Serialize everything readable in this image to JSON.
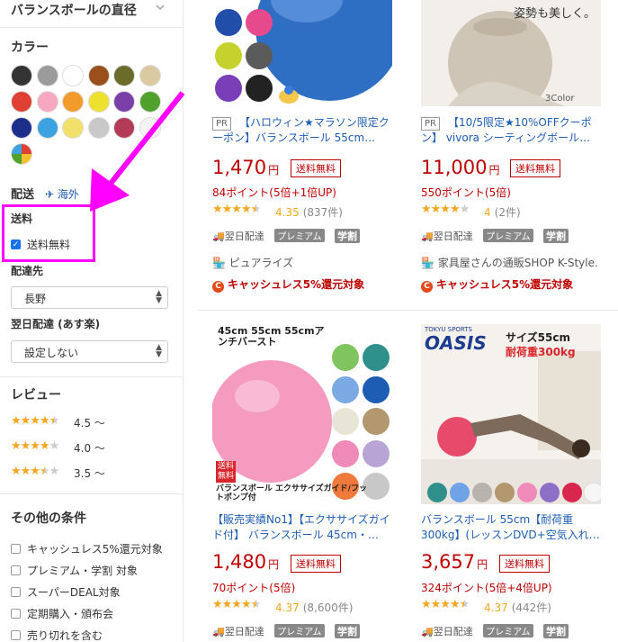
{
  "sidebar": {
    "diameter_heading": "バランスボールの直径",
    "color_title": "カラー",
    "colors": [
      "#333333",
      "#9b9b9b",
      "#ffffff",
      "#9b4f1b",
      "#6b6b2a",
      "#dbc9a1",
      "#e04033",
      "#f6a8c0",
      "#f39a2c",
      "#ede02e",
      "#7b3fa8",
      "#4fa12c",
      "#1c2f8a",
      "#3ca3e0",
      "#f1e06a",
      "#c8c8c8",
      "#b33b58",
      "#f3f3f3"
    ],
    "delivery_title": "配送",
    "overseas_label": "海外",
    "shipping_title": "送料",
    "free_shipping_label": "送料無料",
    "delivery_to_title": "配達先",
    "delivery_to_value": "長野",
    "next_day_title": "翌日配達 (あす楽)",
    "next_day_value": "設定しない",
    "review_title": "レビュー",
    "reviews": [
      {
        "stars": 4.5,
        "label": "4.5 〜"
      },
      {
        "stars": 4.0,
        "label": "4.0 〜"
      },
      {
        "stars": 3.5,
        "label": "3.5 〜"
      }
    ],
    "other_title": "その他の条件",
    "others": [
      "キャッシュレス5%還元対象",
      "プレミアム・学割 対象",
      "スーパーDEAL対象",
      "定期購入・頒布会",
      "売り切れを含む"
    ]
  },
  "products": [
    {
      "pr": "PR",
      "title": "【ハロウィン★マラソン限定クーポン】バランスボール 55cm…",
      "price": "1,470",
      "yen": "円",
      "free_shipping": "送料無料",
      "points": "84ポイント(5倍+1倍UP)",
      "rating": 4.35,
      "rating_text": "4.35",
      "reviews": "(837件)",
      "badge_next": "翌日配達",
      "badge_premium": "プレミアム",
      "badge_gaku": "学割",
      "shop": "ピュアライズ",
      "cashless": "キャッシュレス5%還元対象"
    },
    {
      "pr": "PR",
      "title": "【10/5限定★10%OFFクーポン】 vivora シーティングボール…",
      "img_text": "姿勢も美しく。",
      "img_sub": "3Color",
      "price": "11,000",
      "yen": "円",
      "free_shipping": "送料無料",
      "points": "550ポイント(5倍)",
      "rating": 4,
      "rating_text": "4",
      "reviews": "(2件)",
      "badge_next": "翌日配達",
      "badge_premium": "プレミアム",
      "badge_gaku": "学割",
      "shop": "家具屋さんの通販SHOP K-Style.",
      "cashless": "キャッシュレス5%還元対象"
    },
    {
      "title": "【販売実績No1】【エクササイズガイド付】 バランスボール 45cm・…",
      "img_text": "45cm 55cm 55cmアンチバースト",
      "img_ship": "送料無料",
      "img_caption": "バランスボール エクササイズガイド/フットポンプ付",
      "price": "1,480",
      "yen": "円",
      "free_shipping": "送料無料",
      "points": "70ポイント(5倍)",
      "rating": 4.37,
      "rating_text": "4.37",
      "reviews": "(8,600件)",
      "badge_next": "翌日配達",
      "badge_premium": "プレミアム",
      "badge_gaku": "学割"
    },
    {
      "title": "バランスボール 55cm【耐荷重300kg】(レッスンDVD+空気入れ…",
      "img_brand_top": "TOKYU SPORTS",
      "img_brand": "OASIS",
      "img_size": "サイズ55cm",
      "img_load": "耐荷重300kg",
      "price": "3,657",
      "yen": "円",
      "free_shipping": "送料無料",
      "points": "324ポイント(5倍+4倍UP)",
      "rating": 4.37,
      "rating_text": "4.37",
      "reviews": "(442件)",
      "badge_next": "翌日配達",
      "badge_premium": "プレミアム",
      "badge_gaku": "学割"
    }
  ]
}
